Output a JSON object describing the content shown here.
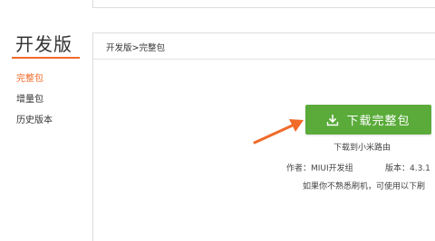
{
  "sidebar": {
    "title": "开发版",
    "items": [
      {
        "label": "完整包",
        "active": true
      },
      {
        "label": "增量包",
        "active": false
      },
      {
        "label": "历史版本",
        "active": false
      }
    ]
  },
  "main": {
    "breadcrumb": "开发版>完整包",
    "download_button": {
      "label": "下载完整包",
      "icon": "download-icon"
    },
    "sub_link": "下载到小米路由",
    "author": "作者：MIUI开发组",
    "version": "版本：4.3.1",
    "hint": "如果你不熟悉刷机，可使用以下刷"
  },
  "colors": {
    "accent": "#f06a2a",
    "button_green": "#5aab3a",
    "arrow": "#f06a2a"
  }
}
